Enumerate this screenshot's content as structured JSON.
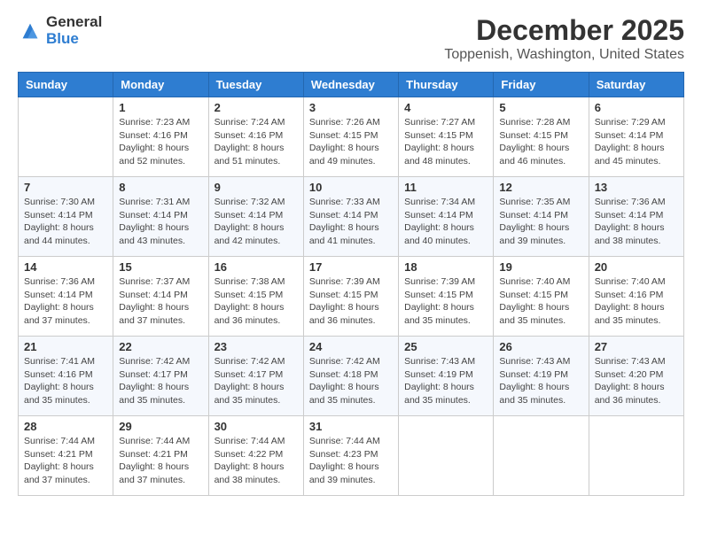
{
  "logo": {
    "general": "General",
    "blue": "Blue"
  },
  "title": "December 2025",
  "location": "Toppenish, Washington, United States",
  "days_of_week": [
    "Sunday",
    "Monday",
    "Tuesday",
    "Wednesday",
    "Thursday",
    "Friday",
    "Saturday"
  ],
  "weeks": [
    [
      {
        "day": "",
        "sunrise": "",
        "sunset": "",
        "daylight": ""
      },
      {
        "day": "1",
        "sunrise": "Sunrise: 7:23 AM",
        "sunset": "Sunset: 4:16 PM",
        "daylight": "Daylight: 8 hours and 52 minutes."
      },
      {
        "day": "2",
        "sunrise": "Sunrise: 7:24 AM",
        "sunset": "Sunset: 4:16 PM",
        "daylight": "Daylight: 8 hours and 51 minutes."
      },
      {
        "day": "3",
        "sunrise": "Sunrise: 7:26 AM",
        "sunset": "Sunset: 4:15 PM",
        "daylight": "Daylight: 8 hours and 49 minutes."
      },
      {
        "day": "4",
        "sunrise": "Sunrise: 7:27 AM",
        "sunset": "Sunset: 4:15 PM",
        "daylight": "Daylight: 8 hours and 48 minutes."
      },
      {
        "day": "5",
        "sunrise": "Sunrise: 7:28 AM",
        "sunset": "Sunset: 4:15 PM",
        "daylight": "Daylight: 8 hours and 46 minutes."
      },
      {
        "day": "6",
        "sunrise": "Sunrise: 7:29 AM",
        "sunset": "Sunset: 4:14 PM",
        "daylight": "Daylight: 8 hours and 45 minutes."
      }
    ],
    [
      {
        "day": "7",
        "sunrise": "Sunrise: 7:30 AM",
        "sunset": "Sunset: 4:14 PM",
        "daylight": "Daylight: 8 hours and 44 minutes."
      },
      {
        "day": "8",
        "sunrise": "Sunrise: 7:31 AM",
        "sunset": "Sunset: 4:14 PM",
        "daylight": "Daylight: 8 hours and 43 minutes."
      },
      {
        "day": "9",
        "sunrise": "Sunrise: 7:32 AM",
        "sunset": "Sunset: 4:14 PM",
        "daylight": "Daylight: 8 hours and 42 minutes."
      },
      {
        "day": "10",
        "sunrise": "Sunrise: 7:33 AM",
        "sunset": "Sunset: 4:14 PM",
        "daylight": "Daylight: 8 hours and 41 minutes."
      },
      {
        "day": "11",
        "sunrise": "Sunrise: 7:34 AM",
        "sunset": "Sunset: 4:14 PM",
        "daylight": "Daylight: 8 hours and 40 minutes."
      },
      {
        "day": "12",
        "sunrise": "Sunrise: 7:35 AM",
        "sunset": "Sunset: 4:14 PM",
        "daylight": "Daylight: 8 hours and 39 minutes."
      },
      {
        "day": "13",
        "sunrise": "Sunrise: 7:36 AM",
        "sunset": "Sunset: 4:14 PM",
        "daylight": "Daylight: 8 hours and 38 minutes."
      }
    ],
    [
      {
        "day": "14",
        "sunrise": "Sunrise: 7:36 AM",
        "sunset": "Sunset: 4:14 PM",
        "daylight": "Daylight: 8 hours and 37 minutes."
      },
      {
        "day": "15",
        "sunrise": "Sunrise: 7:37 AM",
        "sunset": "Sunset: 4:14 PM",
        "daylight": "Daylight: 8 hours and 37 minutes."
      },
      {
        "day": "16",
        "sunrise": "Sunrise: 7:38 AM",
        "sunset": "Sunset: 4:15 PM",
        "daylight": "Daylight: 8 hours and 36 minutes."
      },
      {
        "day": "17",
        "sunrise": "Sunrise: 7:39 AM",
        "sunset": "Sunset: 4:15 PM",
        "daylight": "Daylight: 8 hours and 36 minutes."
      },
      {
        "day": "18",
        "sunrise": "Sunrise: 7:39 AM",
        "sunset": "Sunset: 4:15 PM",
        "daylight": "Daylight: 8 hours and 35 minutes."
      },
      {
        "day": "19",
        "sunrise": "Sunrise: 7:40 AM",
        "sunset": "Sunset: 4:15 PM",
        "daylight": "Daylight: 8 hours and 35 minutes."
      },
      {
        "day": "20",
        "sunrise": "Sunrise: 7:40 AM",
        "sunset": "Sunset: 4:16 PM",
        "daylight": "Daylight: 8 hours and 35 minutes."
      }
    ],
    [
      {
        "day": "21",
        "sunrise": "Sunrise: 7:41 AM",
        "sunset": "Sunset: 4:16 PM",
        "daylight": "Daylight: 8 hours and 35 minutes."
      },
      {
        "day": "22",
        "sunrise": "Sunrise: 7:42 AM",
        "sunset": "Sunset: 4:17 PM",
        "daylight": "Daylight: 8 hours and 35 minutes."
      },
      {
        "day": "23",
        "sunrise": "Sunrise: 7:42 AM",
        "sunset": "Sunset: 4:17 PM",
        "daylight": "Daylight: 8 hours and 35 minutes."
      },
      {
        "day": "24",
        "sunrise": "Sunrise: 7:42 AM",
        "sunset": "Sunset: 4:18 PM",
        "daylight": "Daylight: 8 hours and 35 minutes."
      },
      {
        "day": "25",
        "sunrise": "Sunrise: 7:43 AM",
        "sunset": "Sunset: 4:19 PM",
        "daylight": "Daylight: 8 hours and 35 minutes."
      },
      {
        "day": "26",
        "sunrise": "Sunrise: 7:43 AM",
        "sunset": "Sunset: 4:19 PM",
        "daylight": "Daylight: 8 hours and 35 minutes."
      },
      {
        "day": "27",
        "sunrise": "Sunrise: 7:43 AM",
        "sunset": "Sunset: 4:20 PM",
        "daylight": "Daylight: 8 hours and 36 minutes."
      }
    ],
    [
      {
        "day": "28",
        "sunrise": "Sunrise: 7:44 AM",
        "sunset": "Sunset: 4:21 PM",
        "daylight": "Daylight: 8 hours and 37 minutes."
      },
      {
        "day": "29",
        "sunrise": "Sunrise: 7:44 AM",
        "sunset": "Sunset: 4:21 PM",
        "daylight": "Daylight: 8 hours and 37 minutes."
      },
      {
        "day": "30",
        "sunrise": "Sunrise: 7:44 AM",
        "sunset": "Sunset: 4:22 PM",
        "daylight": "Daylight: 8 hours and 38 minutes."
      },
      {
        "day": "31",
        "sunrise": "Sunrise: 7:44 AM",
        "sunset": "Sunset: 4:23 PM",
        "daylight": "Daylight: 8 hours and 39 minutes."
      },
      {
        "day": "",
        "sunrise": "",
        "sunset": "",
        "daylight": ""
      },
      {
        "day": "",
        "sunrise": "",
        "sunset": "",
        "daylight": ""
      },
      {
        "day": "",
        "sunrise": "",
        "sunset": "",
        "daylight": ""
      }
    ]
  ]
}
